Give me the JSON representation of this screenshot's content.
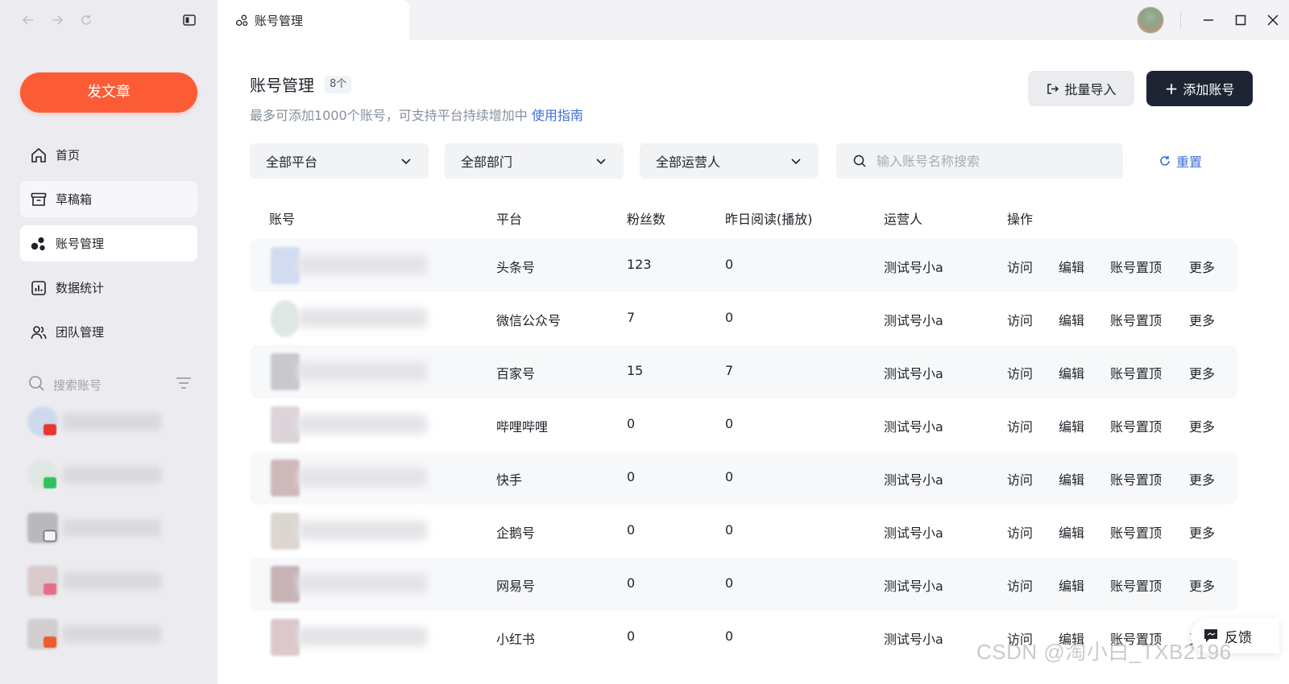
{
  "nav": {
    "back_icon": "arrow-left-icon",
    "forward_icon": "arrow-right-icon",
    "reload_icon": "reload-icon",
    "sidebar_toggle_icon": "sidebar-toggle-icon"
  },
  "sidebar": {
    "publish_label": "发文章",
    "menu": [
      {
        "label": "首页",
        "icon": "home-icon"
      },
      {
        "label": "草稿箱",
        "icon": "archive-icon"
      },
      {
        "label": "账号管理",
        "icon": "accounts-icon"
      },
      {
        "label": "数据统计",
        "icon": "chart-icon"
      },
      {
        "label": "团队管理",
        "icon": "team-icon"
      }
    ],
    "search_placeholder": "搜索账号"
  },
  "tab": {
    "label": "账号管理"
  },
  "page": {
    "title": "账号管理",
    "count": "8个",
    "subtitle": "最多可添加1000个账号，可支持平台持续增加中",
    "guide_link": "使用指南",
    "import_label": "批量导入",
    "add_label": "添加账号"
  },
  "filters": {
    "platform": "全部平台",
    "department": "全部部门",
    "operator": "全部运营人",
    "search_placeholder": "输入账号名称搜索",
    "reset_label": "重置"
  },
  "table": {
    "headers": [
      "账号",
      "平台",
      "粉丝数",
      "昨日阅读(播放)",
      "运营人",
      "操作"
    ],
    "actions": [
      "访问",
      "编辑",
      "账号置顶",
      "更多"
    ],
    "rows": [
      {
        "platform": "头条号",
        "fans": "123",
        "reads": "0",
        "operator": "测试号小a"
      },
      {
        "platform": "微信公众号",
        "fans": "7",
        "reads": "0",
        "operator": "测试号小a"
      },
      {
        "platform": "百家号",
        "fans": "15",
        "reads": "7",
        "operator": "测试号小a"
      },
      {
        "platform": "哔哩哔哩",
        "fans": "0",
        "reads": "0",
        "operator": "测试号小a"
      },
      {
        "platform": "快手",
        "fans": "0",
        "reads": "0",
        "operator": "测试号小a"
      },
      {
        "platform": "企鹅号",
        "fans": "0",
        "reads": "0",
        "operator": "测试号小a"
      },
      {
        "platform": "网易号",
        "fans": "0",
        "reads": "0",
        "operator": "测试号小a"
      },
      {
        "platform": "小红书",
        "fans": "0",
        "reads": "0",
        "operator": "测试号小a"
      }
    ]
  },
  "feedback_label": "反馈",
  "watermark": "CSDN @淘小白_TXB2196",
  "colors": {
    "accent": "#fb5c36",
    "primary_dark": "#1d2433",
    "link": "#3d6fd6"
  }
}
